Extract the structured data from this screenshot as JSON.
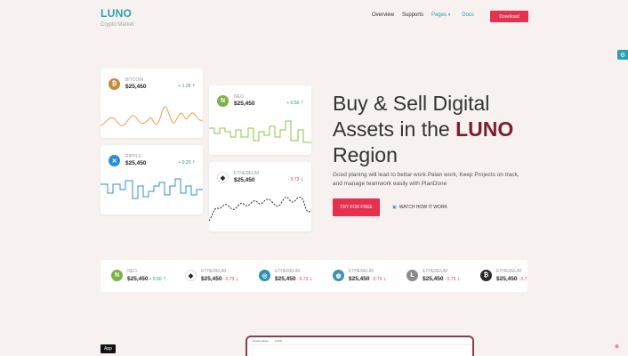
{
  "brand": {
    "logo": "LUNO",
    "tagline": "Crypto Market"
  },
  "nav": {
    "overview": "Overview",
    "supports": "Supports",
    "pages": "Pages",
    "docs": "Docs",
    "download": "Download"
  },
  "hero": {
    "line1": "Buy & Sell Digital",
    "line2_pre": "Assets in the",
    "line2_brand": "LUNO",
    "line3": "Region",
    "description": "Good planing will lead to bettar work.Palan work, Keep Projects on track, and manage teamwork easily with PlanDone",
    "try_label": "TRY FOR FREE",
    "watch_label": "WATCH HOW IT WORK"
  },
  "cards": [
    {
      "name": "BITCOIN",
      "price": "$25,450",
      "change": "+ 1.25 ⇡",
      "icon": "bitcoin-icon",
      "icon_color": "#c68a3f",
      "glyph": "₿",
      "line_color": "#f0a04b"
    },
    {
      "name": "NEO",
      "price": "$25,450",
      "change": "+ 0.50 ⇡",
      "icon": "neo-icon",
      "icon_color": "#7fb04a",
      "glyph": "N",
      "line_color": "#8cc63f"
    },
    {
      "name": "RIPPLE",
      "price": "$25,450",
      "change": "+ 0.25 ⇡",
      "icon": "ripple-icon",
      "icon_color": "#2c8fd6",
      "glyph": "✕",
      "line_color": "#2c8fd6"
    },
    {
      "name": "ETHEREUM",
      "price": "$25,450",
      "change": "- 0.73 ⇣",
      "icon": "ethereum-icon",
      "icon_color": "#ffffff",
      "glyph": "◆",
      "line_color": "#222222"
    }
  ],
  "ticker": [
    {
      "name": "NEO",
      "price": "$25,450",
      "change": "+ 0.50 ⇡",
      "icon": "neo-icon",
      "icon_color": "#7fb04a",
      "glyph": "N",
      "up": true
    },
    {
      "name": "ETHEREUM",
      "price": "$25,450",
      "change": "- 0.73 ⇣",
      "icon": "ethereum-icon",
      "icon_color": "#ffffff",
      "glyph": "◆",
      "up": false
    },
    {
      "name": "ETHEREUM",
      "price": "$25,450",
      "change": "- 0.73 ⇣",
      "icon": "coin-icon",
      "icon_color": "#2c8fb6",
      "glyph": "◎",
      "up": false
    },
    {
      "name": "ETHEREUM",
      "price": "$25,450",
      "change": "- 0.73 ⇣",
      "icon": "globe-coin-icon",
      "icon_color": "#3f8fb0",
      "glyph": "◍",
      "up": false
    },
    {
      "name": "ETHEREUM",
      "price": "$25,450",
      "change": "- 0.73 ⇣",
      "icon": "litecoin-icon",
      "icon_color": "#8b8b8b",
      "glyph": "Ł",
      "up": false
    },
    {
      "name": "ETHEREUM",
      "price": "$25,450",
      "change": "- 0.7",
      "icon": "bitcoin-icon",
      "icon_color": "#2b2b2b",
      "glyph": "₿",
      "up": false
    }
  ],
  "colors": {
    "accent": "#2aa0b1",
    "primary_button": "#e5304f",
    "up": "#1a9a7a",
    "down": "#e5304f"
  },
  "app_tag": "App",
  "preview": {
    "title": "Crypto Admin",
    "logo": "LUNO"
  }
}
